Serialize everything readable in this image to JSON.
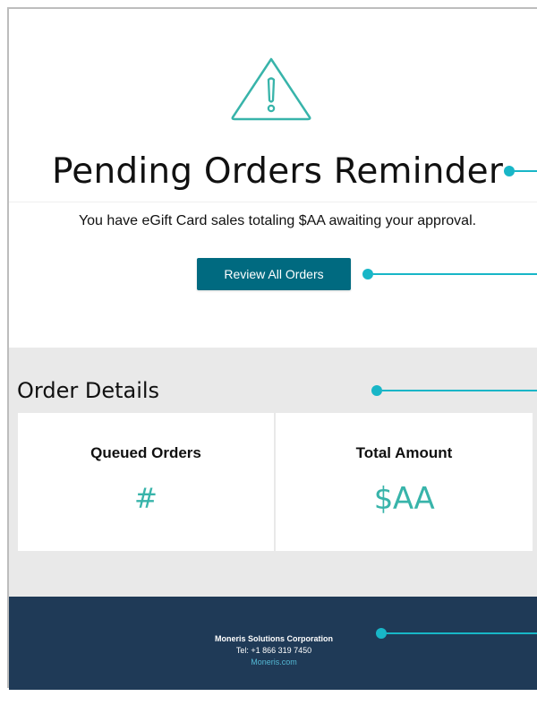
{
  "email": {
    "title": "Pending Orders Reminder",
    "message": "You have eGift Card sales totaling $AA awaiting your approval.",
    "review_button_label": "Review All Orders"
  },
  "order_details": {
    "heading": "Order Details",
    "cards": [
      {
        "label": "Queued Orders",
        "value": "#"
      },
      {
        "label": "Total Amount",
        "value": "$AA"
      }
    ]
  },
  "footer": {
    "company": "Moneris Solutions Corporation",
    "phone": "Tel: +1 866 319 7450",
    "link": "Moneris.com"
  },
  "icons": {
    "warning": "warning-triangle-icon"
  },
  "colors": {
    "accent_teal": "#38b4aa",
    "button_blue": "#006a80",
    "footer_navy": "#1f3a57",
    "connector_cyan": "#18b6c7",
    "section_gray": "#e9e9e9"
  }
}
